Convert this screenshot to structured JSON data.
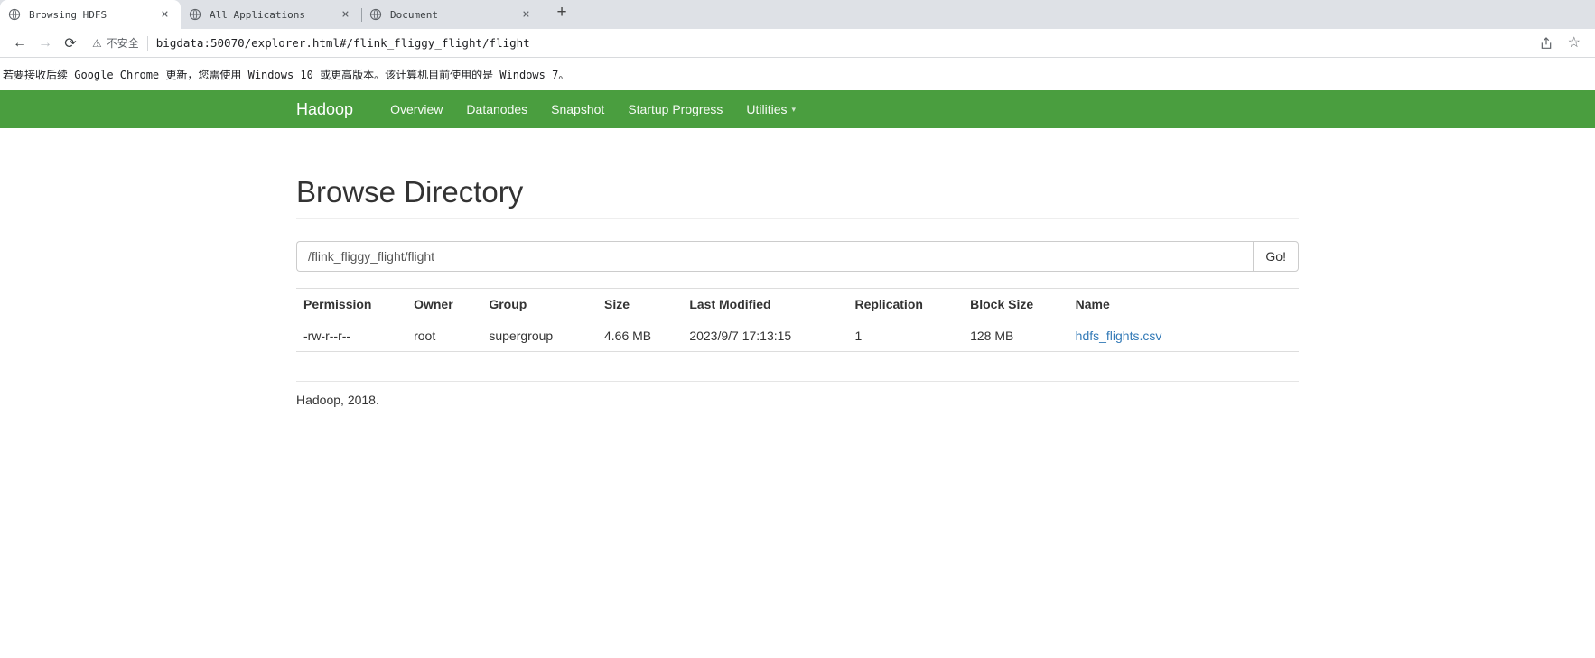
{
  "icons": {
    "back": "←",
    "forward": "→",
    "reload": "⟳",
    "warning": "⚠",
    "star": "☆",
    "new_tab": "+",
    "close": "×",
    "caret": "▾"
  },
  "browser": {
    "tabs": [
      {
        "title": "Browsing HDFS"
      },
      {
        "title": "All Applications"
      },
      {
        "title": "Document"
      }
    ],
    "toolbar": {
      "security_label": "不安全",
      "url": "bigdata:50070/explorer.html#/flink_fliggy_flight/flight"
    },
    "infobar": {
      "message": "若要接收后续 Google Chrome 更新，您需使用 Windows 10 或更高版本。该计算机目前使用的是 Windows 7。"
    }
  },
  "navbar": {
    "brand": "Hadoop",
    "items": [
      "Overview",
      "Datanodes",
      "Snapshot",
      "Startup Progress",
      "Utilities"
    ]
  },
  "page": {
    "title": "Browse Directory",
    "path_value": "/flink_fliggy_flight/flight",
    "go_label": "Go!",
    "table": {
      "headers": [
        "Permission",
        "Owner",
        "Group",
        "Size",
        "Last Modified",
        "Replication",
        "Block Size",
        "Name"
      ],
      "rows": [
        {
          "permission": "-rw-r--r--",
          "owner": "root",
          "group": "supergroup",
          "size": "4.66 MB",
          "last_modified": "2023/9/7 17:13:15",
          "replication": "1",
          "block_size": "128 MB",
          "name": "hdfs_flights.csv"
        }
      ]
    },
    "footer": "Hadoop, 2018."
  },
  "colors": {
    "navbar_green": "#4a9e3f",
    "link_blue": "#337ab7"
  }
}
